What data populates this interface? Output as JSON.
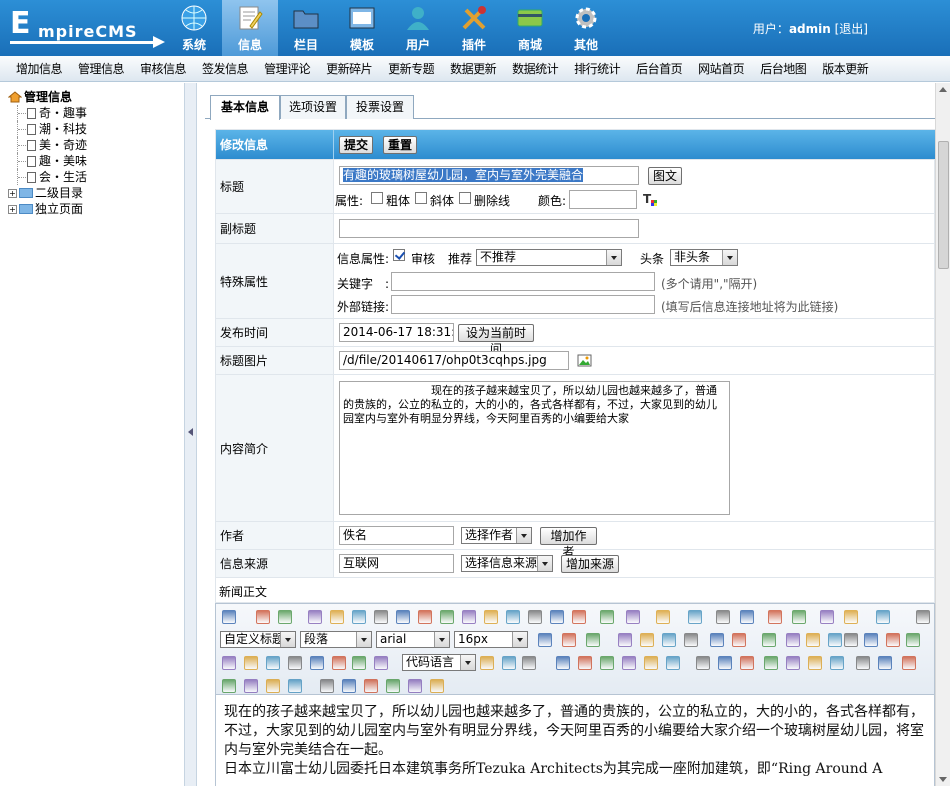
{
  "logo": {
    "first": "E",
    "rest": "mpireCMS"
  },
  "topnav": [
    {
      "label": "系统",
      "icon": "globe-icon",
      "color": "#3aa0e6"
    },
    {
      "label": "信息",
      "icon": "edit-icon",
      "color": "#f0d060"
    },
    {
      "label": "栏目",
      "icon": "folder-icon",
      "color": "#5c8fc6"
    },
    {
      "label": "模板",
      "icon": "template-icon",
      "color": "#7fb6e6"
    },
    {
      "label": "用户",
      "icon": "user-icon",
      "color": "#3fb0c8"
    },
    {
      "label": "插件",
      "icon": "tools-icon",
      "color": "#e0a030"
    },
    {
      "label": "商城",
      "icon": "card-icon",
      "color": "#8cc84a"
    },
    {
      "label": "其他",
      "icon": "gear-icon",
      "color": "#c0c0c0"
    }
  ],
  "user": {
    "prefix": "用户：",
    "name": "admin",
    "logout": "[退出]"
  },
  "subnav": [
    "增加信息",
    "管理信息",
    "审核信息",
    "签发信息",
    "管理评论",
    "更新碎片",
    "更新专题",
    "数据更新",
    "数据统计",
    "排行统计",
    "后台首页",
    "网站首页",
    "后台地图",
    "版本更新"
  ],
  "tree": {
    "root": "管理信息",
    "children": [
      "奇・趣事",
      "潮・科技",
      "美・奇迹",
      "趣・美味",
      "会・生活"
    ],
    "folders": [
      "二级目录",
      "独立页面"
    ]
  },
  "tabs": [
    "基本信息",
    "选项设置",
    "投票设置"
  ],
  "form": {
    "header_label": "修改信息",
    "submit": "提交",
    "reset": "重置",
    "title_label": "标题",
    "title_value": "有趣的玻璃树屋幼儿园，室内与室外完美融合",
    "title_btn": "图文",
    "attr_label": "属性:",
    "bold": "粗体",
    "italic": "斜体",
    "strike": "删除线",
    "color_label": "颜色:",
    "subtitle_label": "副标题",
    "special_label": "特殊属性",
    "info_attr": "信息属性:",
    "audit": "审核",
    "recommend_label": "推荐",
    "recommend_value": "不推荐",
    "headline_label": "头条",
    "headline_value": "非头条",
    "keywords_label": "关键字　:",
    "keywords_hint": "(多个请用\",\"隔开)",
    "link_label": "外部链接:",
    "link_hint": "(填写后信息连接地址将为此链接)",
    "pubtime_label": "发布时间",
    "pubtime_value": "2014-06-17 18:31:04",
    "pubtime_btn": "设为当前时间",
    "titlepic_label": "标题图片",
    "titlepic_value": "/d/file/20140617/ohp0t3cqhps.jpg",
    "summary_label": "内容简介",
    "summary_value": "　　　　　　　　现在的孩子越来越宝贝了，所以幼儿园也越来越多了，普通的贵族的，公立的私立的，大的小的，各式各样都有，不过，大家见到的幼儿园室内与室外有明显分界线，今天阿里百秀的小编要给大家",
    "author_label": "作者",
    "author_value": "佚名",
    "author_select": "选择作者",
    "author_btn": "增加作者",
    "source_label": "信息来源",
    "source_value": "互联网",
    "source_select": "选择信息来源",
    "source_btn": "增加来源",
    "body_label": "新闻正文"
  },
  "editor": {
    "style_select": "自定义标题",
    "para_select": "段落",
    "font_select": "arial",
    "size_select": "16px",
    "code_select": "代码语言",
    "content": "现在的孩子越来越宝贝了，所以幼儿园也越来越多了，普通的贵族的，公立的私立的，大的小的，各式各样都有，不过，大家见到的幼儿园室内与室外有明显分界线，今天阿里百秀的小编要给大家介绍一个玻璃树屋幼儿园，将室内与室外完美结合在一起。",
    "content2": "日本立川富士幼儿园委托日本建筑事务所Tezuka Architects为其完成一座附加建筑，即“Ring Around A"
  }
}
